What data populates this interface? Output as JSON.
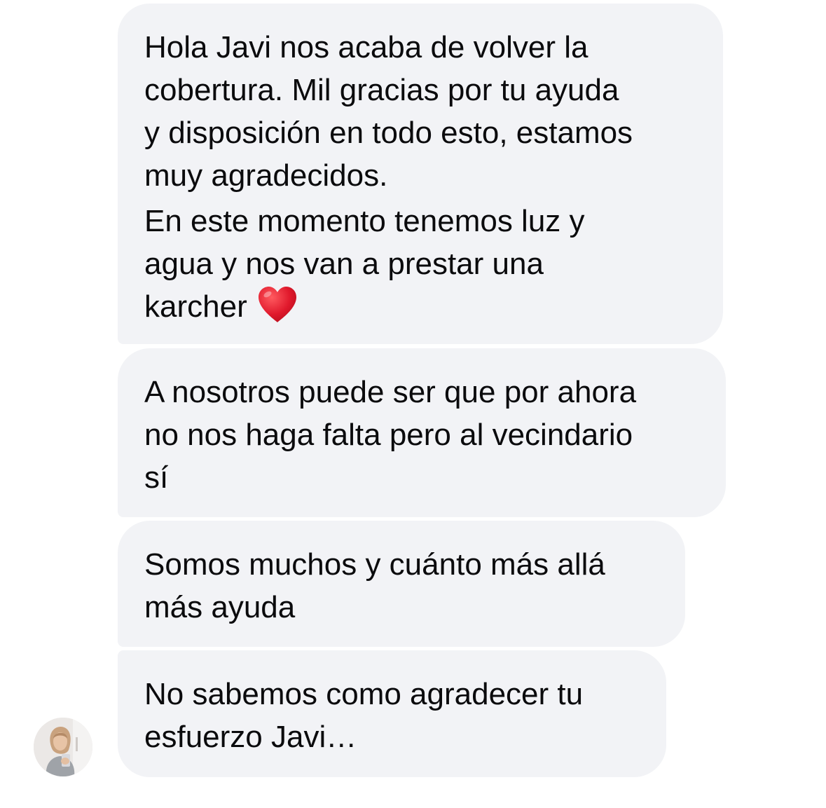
{
  "conversation": {
    "messages": [
      {
        "paragraphs": [
          "Hola Javi nos acaba de volver la\ncobertura. Mil gracias por tu ayuda\ny disposición en todo esto, estamos\nmuy agradecidos.",
          "En este momento tenemos luz y\nagua y nos van a prestar una\nkarcher"
        ],
        "emoji": "red-heart-icon"
      },
      {
        "paragraphs": [
          "A nosotros puede ser que por ahora\nno nos haga falta pero al vecindario\nsí"
        ]
      },
      {
        "paragraphs": [
          "Somos muchos y cuánto más allá\nmás ayuda"
        ]
      },
      {
        "paragraphs": [
          "No sabemos como agradecer tu\nesfuerzo Javi…"
        ]
      }
    ],
    "sender_avatar": "profile-photo"
  },
  "colors": {
    "bubble_background": "#f2f3f6",
    "text": "#0b0b0d",
    "heart": "#e0192c"
  }
}
